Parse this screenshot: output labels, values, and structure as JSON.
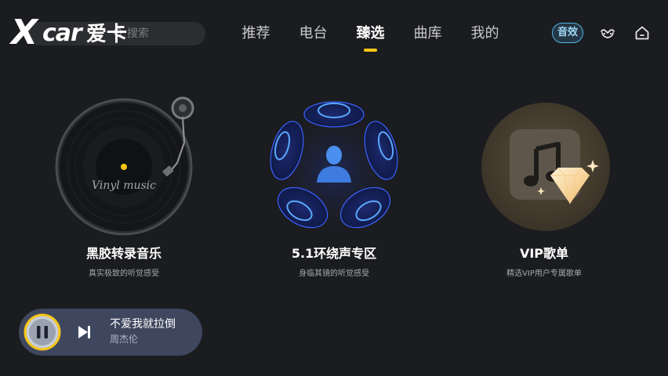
{
  "logo": {
    "x": "X",
    "car": "car",
    "cn": "爱卡"
  },
  "search": {
    "placeholder": "搜索",
    "icon": "search-icon"
  },
  "tabs": [
    {
      "label": "推荐"
    },
    {
      "label": "电台"
    },
    {
      "label": "臻选",
      "active": true
    },
    {
      "label": "曲库"
    },
    {
      "label": "我的"
    }
  ],
  "header": {
    "sfx_label": "音效",
    "car_icon": "car-icon",
    "home_icon": "home-icon"
  },
  "cards": [
    {
      "title": "黑胶转录音乐",
      "subtitle": "真实极致的听觉感受",
      "art_text": "Vinyl music"
    },
    {
      "title": "5.1环绕声专区",
      "subtitle": "身临其镜的听觉感受"
    },
    {
      "title": "VIP歌单",
      "subtitle": "精选VIP用户专属歌单"
    }
  ],
  "player": {
    "song": "不爱我就拉倒",
    "artist": "周杰伦",
    "state": "playing"
  },
  "colors": {
    "accent": "#f5c518",
    "sfx": "#4fb3e8",
    "background": "#1b1c1f",
    "player": "#3e475e"
  }
}
